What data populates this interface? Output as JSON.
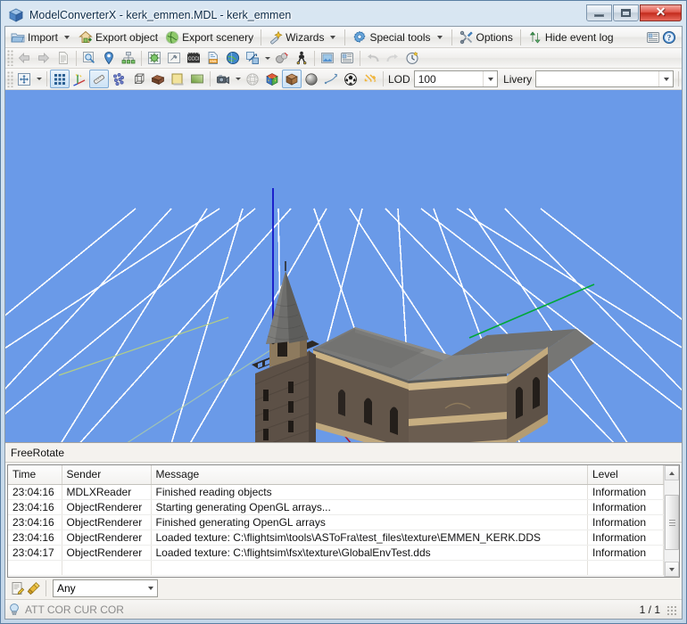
{
  "window": {
    "title": "ModelConverterX - kerk_emmen.MDL - kerk_emmen",
    "app_icon": "cube-icon",
    "buttons": {
      "minimize": "minimize-button",
      "maximize": "maximize-button",
      "close": "close-button",
      "close_glyph": "✕"
    }
  },
  "menu": {
    "items": [
      {
        "label": "Import",
        "icon": "folder-open-icon",
        "has_dropdown": true
      },
      {
        "label": "Export object",
        "icon": "house-export-icon",
        "has_dropdown": false
      },
      {
        "label": "Export scenery",
        "icon": "globe-export-icon",
        "has_dropdown": false
      },
      {
        "label": "Wizards",
        "icon": "magic-wand-icon",
        "has_dropdown": true
      },
      {
        "label": "Special tools",
        "icon": "gear-icon",
        "has_dropdown": true
      },
      {
        "label": "Options",
        "icon": "tools-icon",
        "has_dropdown": false
      },
      {
        "label": "Hide event log",
        "icon": "updown-arrows-icon",
        "has_dropdown": false
      }
    ],
    "right_icons": [
      {
        "name": "report-icon"
      },
      {
        "name": "help-icon"
      }
    ]
  },
  "toolbar_top": {
    "buttons": [
      {
        "name": "back-arrow-icon",
        "enabled": false
      },
      {
        "name": "forward-arrow-icon",
        "enabled": false
      },
      {
        "name": "document-icon",
        "enabled": false
      },
      {
        "name": "separator"
      },
      {
        "name": "object-inspector-icon"
      },
      {
        "name": "location-pin-icon"
      },
      {
        "name": "hierarchy-icon"
      },
      {
        "name": "separator"
      },
      {
        "name": "material-editor-icon"
      },
      {
        "name": "attached-tools-icon"
      },
      {
        "name": "animation-icon"
      },
      {
        "name": "xml-file-icon"
      },
      {
        "name": "globe-icon"
      },
      {
        "name": "scale-icon",
        "has_dropdown": true
      },
      {
        "name": "physics-icon"
      },
      {
        "name": "crash-tree-icon"
      },
      {
        "name": "separator"
      },
      {
        "name": "image-icon"
      },
      {
        "name": "report-list-icon"
      },
      {
        "name": "separator"
      },
      {
        "name": "undo-icon",
        "enabled": false
      },
      {
        "name": "redo-icon",
        "enabled": false
      },
      {
        "name": "history-icon"
      }
    ]
  },
  "toolbar_bottom": {
    "buttons": [
      {
        "name": "fit-to-screen-icon",
        "has_dropdown": true
      },
      {
        "name": "separator"
      },
      {
        "name": "grid-icon",
        "checked": true
      },
      {
        "name": "axis-icon"
      },
      {
        "name": "ruler-icon",
        "checked": true
      },
      {
        "name": "vertices-icon"
      },
      {
        "name": "wireframe-box-icon"
      },
      {
        "name": "texture-brick-icon"
      },
      {
        "name": "flat-color-icon"
      },
      {
        "name": "gradient-icon"
      },
      {
        "name": "separator"
      },
      {
        "name": "camera-icon",
        "has_dropdown": true
      },
      {
        "name": "mesh-sphere-icon"
      },
      {
        "name": "color-cube-icon"
      },
      {
        "name": "shaded-cube-icon",
        "checked": true
      },
      {
        "name": "lighting-sphere-icon"
      },
      {
        "name": "normals-icon"
      },
      {
        "name": "checker-sphere-icon"
      },
      {
        "name": "collapse-icon"
      },
      {
        "name": "separator"
      }
    ],
    "lod_label": "LOD",
    "lod_value": "100",
    "livery_label": "Livery",
    "livery_value": ""
  },
  "viewport": {
    "mode_label": "FreeRotate",
    "colors": {
      "background": "#6a9ae8",
      "grid": "#ffffff",
      "axis_x": "#b01846",
      "axis_y": "#00a838",
      "axis_z": "#1414c8",
      "wall_stone": "#6b5f54",
      "roof_slate": "#6d6d6d",
      "trim_sand": "#d8c49a"
    },
    "model_name": "kerk_emmen"
  },
  "eventlog": {
    "columns": [
      "Time",
      "Sender",
      "Message",
      "Level"
    ],
    "rows": [
      {
        "time": "23:04:16",
        "sender": "MDLXReader",
        "message": "Finished reading objects",
        "level": "Information"
      },
      {
        "time": "23:04:16",
        "sender": "ObjectRenderer",
        "message": "Starting generating OpenGL arrays...",
        "level": "Information"
      },
      {
        "time": "23:04:16",
        "sender": "ObjectRenderer",
        "message": "Finished generating OpenGL arrays",
        "level": "Information"
      },
      {
        "time": "23:04:16",
        "sender": "ObjectRenderer",
        "message": "Loaded texture: C:\\flightsim\\tools\\ASToFra\\test_files\\texture\\EMMEN_KERK.DDS",
        "level": "Information"
      },
      {
        "time": "23:04:17",
        "sender": "ObjectRenderer",
        "message": "Loaded texture: C:\\flightsim\\fsx\\texture\\GlobalEnvTest.dds",
        "level": "Information"
      }
    ]
  },
  "filterbar": {
    "icons": [
      {
        "name": "edit-log-icon"
      },
      {
        "name": "clear-log-icon"
      }
    ],
    "level_filter_value": "Any"
  },
  "statusbar": {
    "hint_icon": "lightbulb-icon",
    "text": "ATT COR  CUR COR",
    "page_count": "1 / 1"
  }
}
